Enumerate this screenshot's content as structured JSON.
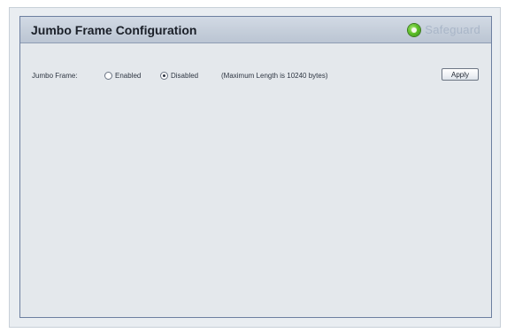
{
  "panel": {
    "title": "Jumbo Frame Configuration",
    "safeguard_label": "Safeguard"
  },
  "jumbo_frame": {
    "label": "Jumbo Frame:",
    "options": [
      {
        "label": "Enabled",
        "selected": false
      },
      {
        "label": "Disabled",
        "selected": true
      }
    ],
    "note": "(Maximum Length is 10240 bytes)"
  },
  "actions": {
    "apply_label": "Apply"
  },
  "colors": {
    "safeguard_green": "#4fb11f",
    "title_bar": "#c5ceda",
    "panel_bg": "#e4e8ec"
  },
  "icons": {
    "safeguard": "safeguard-status-icon",
    "radio": "radio-button"
  }
}
